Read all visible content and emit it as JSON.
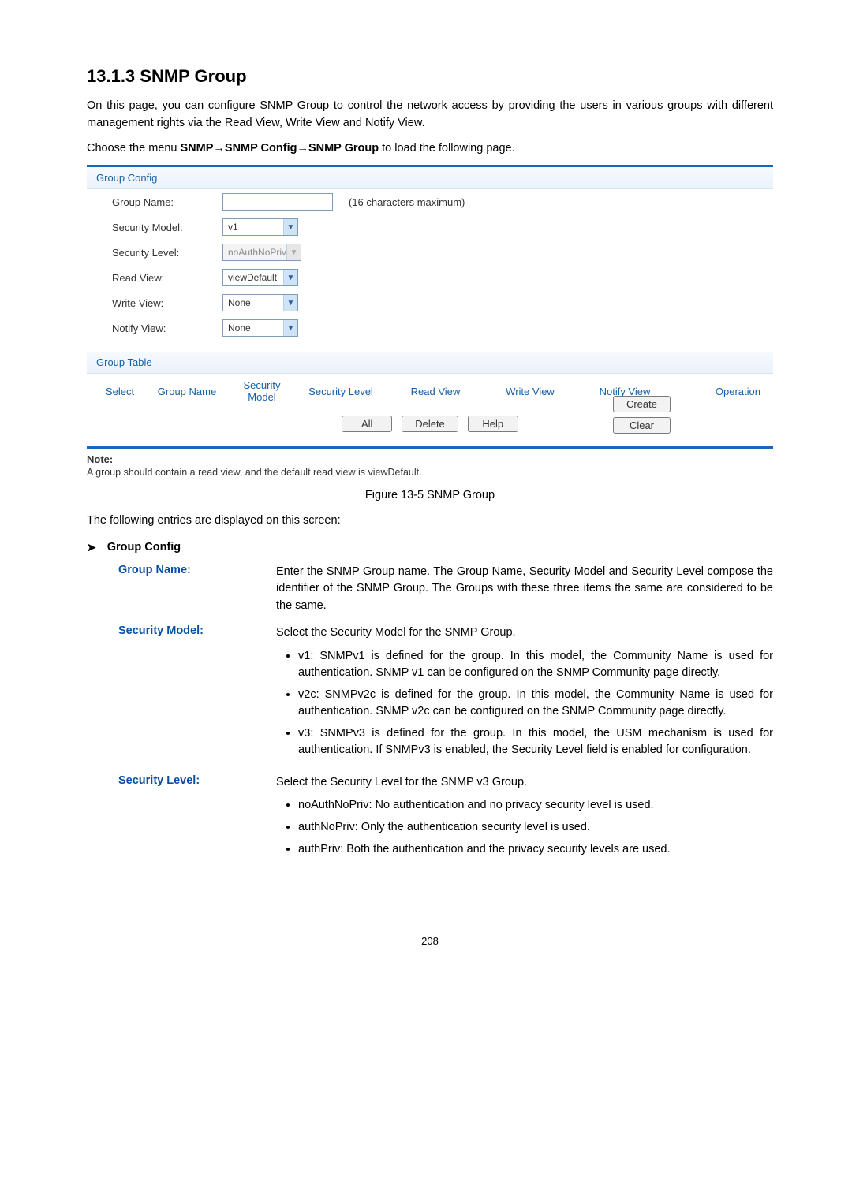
{
  "heading": "13.1.3  SNMP Group",
  "intro_para": "On this page, you can configure SNMP Group to control the network access by providing the users in various groups with different management rights via the Read View, Write View and Notify View.",
  "choose_prefix": "Choose the menu ",
  "breadcrumb_bold": "SNMP→SNMP Config→SNMP Group",
  "choose_suffix": " to load the following page.",
  "panel": {
    "group_config_hdr": "Group Config",
    "group_name_label": "Group Name:",
    "group_name_value": "",
    "group_name_hint": "(16 characters maximum)",
    "security_model_label": "Security Model:",
    "security_model_value": "v1",
    "security_level_label": "Security Level:",
    "security_level_value": "noAuthNoPriv",
    "read_view_label": "Read View:",
    "read_view_value": "viewDefault",
    "write_view_label": "Write View:",
    "write_view_value": "None",
    "notify_view_label": "Notify View:",
    "notify_view_value": "None",
    "btn_create": "Create",
    "btn_clear": "Clear",
    "group_table_hdr": "Group Table",
    "th_select": "Select",
    "th_group_name": "Group Name",
    "th_sec_model": "Security Model",
    "th_sec_level": "Security Level",
    "th_read": "Read View",
    "th_write": "Write View",
    "th_notify": "Notify View",
    "th_op": "Operation",
    "btn_all": "All",
    "btn_delete": "Delete",
    "btn_help": "Help",
    "note_label": "Note:",
    "note_text": "A group should contain a read view, and the default read view is viewDefault."
  },
  "figure_caption": "Figure 13-5 SNMP Group",
  "entries_intro": "The following entries are displayed on this screen:",
  "sub_heading": "Group Config",
  "defs": {
    "group_name": {
      "term": "Group Name:",
      "desc": "Enter the SNMP Group name. The Group Name, Security Model and Security Level compose the identifier of the SNMP Group. The Groups with these three items the same are considered to be the same."
    },
    "sec_model": {
      "term": "Security Model:",
      "desc": "Select the Security Model for the SNMP Group.",
      "items": [
        "v1: SNMPv1 is defined for the group. In this model, the Community Name is used for authentication. SNMP v1 can be configured on the SNMP Community page directly.",
        "v2c: SNMPv2c is defined for the group. In this model, the Community Name is used for authentication. SNMP v2c can be configured on the SNMP Community page directly.",
        "v3: SNMPv3 is defined for the group. In this model, the USM mechanism is used for authentication. If SNMPv3 is enabled, the Security Level field is enabled for configuration."
      ]
    },
    "sec_level": {
      "term": "Security Level:",
      "desc": "Select the Security Level for the SNMP v3 Group.",
      "items": [
        "noAuthNoPriv: No authentication and no privacy security level is used.",
        "authNoPriv: Only the authentication security level is used.",
        "authPriv: Both the authentication and the privacy security levels are used."
      ]
    }
  },
  "page_number": "208"
}
